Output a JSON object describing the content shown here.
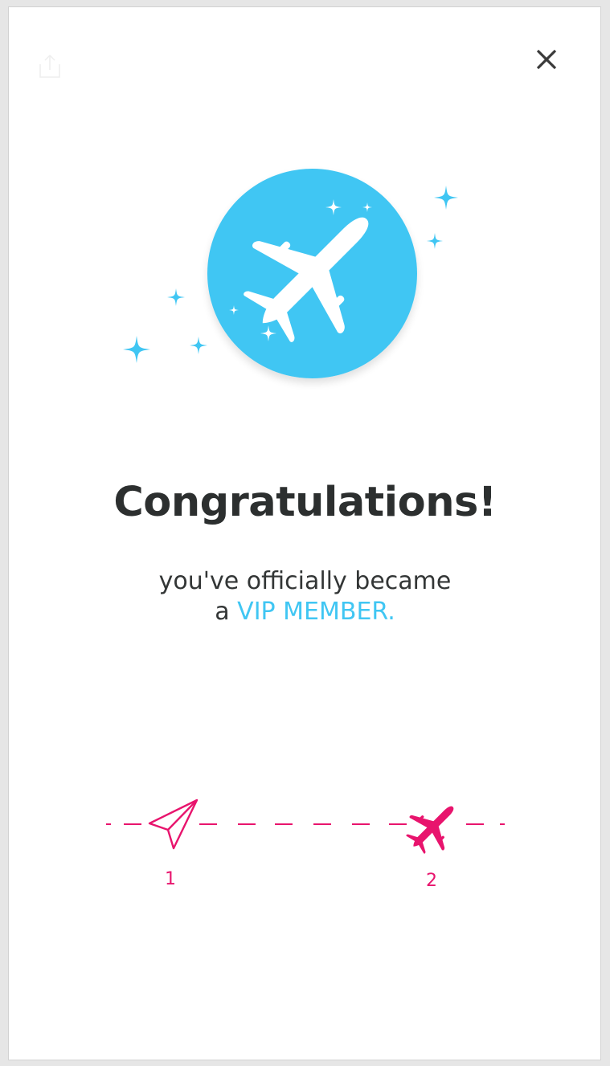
{
  "header": {
    "share_icon": "share-icon",
    "close_icon": "close-icon"
  },
  "hero": {
    "badge_icon": "airplane-icon",
    "badge_color": "#40c6f3",
    "sparkle_color": "#40c6f3"
  },
  "message": {
    "title": "Congratulations!",
    "line1": "you've officially became",
    "line2_prefix": "a ",
    "line2_highlight": "VIP MEMBER."
  },
  "progress": {
    "accent_color": "#e8146d",
    "steps": [
      {
        "label": "1",
        "icon": "paper-plane-icon",
        "state": "completed"
      },
      {
        "label": "2",
        "icon": "airplane-icon",
        "state": "current"
      }
    ]
  }
}
